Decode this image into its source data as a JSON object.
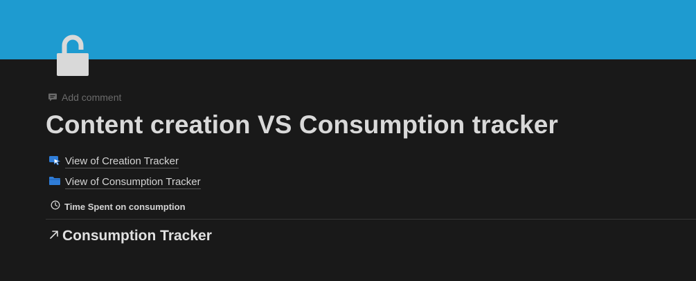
{
  "cover": {
    "color": "#1e9bd0"
  },
  "page": {
    "icon": "unlocked-padlock-icon",
    "add_comment_label": "Add comment",
    "add_comment_icon": "comment-icon",
    "title": "Content creation VS Consumption tracker"
  },
  "links": [
    {
      "label": "View of Creation Tracker",
      "icon": "cursor-click-icon",
      "icon_color": "#2f7dd8"
    },
    {
      "label": "View of Consumption Tracker",
      "icon": "folder-icon",
      "icon_color": "#2f7dd8"
    }
  ],
  "time_row": {
    "label": "Time Spent on consumption",
    "icon": "clock-icon"
  },
  "section": {
    "heading": "Consumption Tracker",
    "icon": "arrow-up-right-icon"
  }
}
